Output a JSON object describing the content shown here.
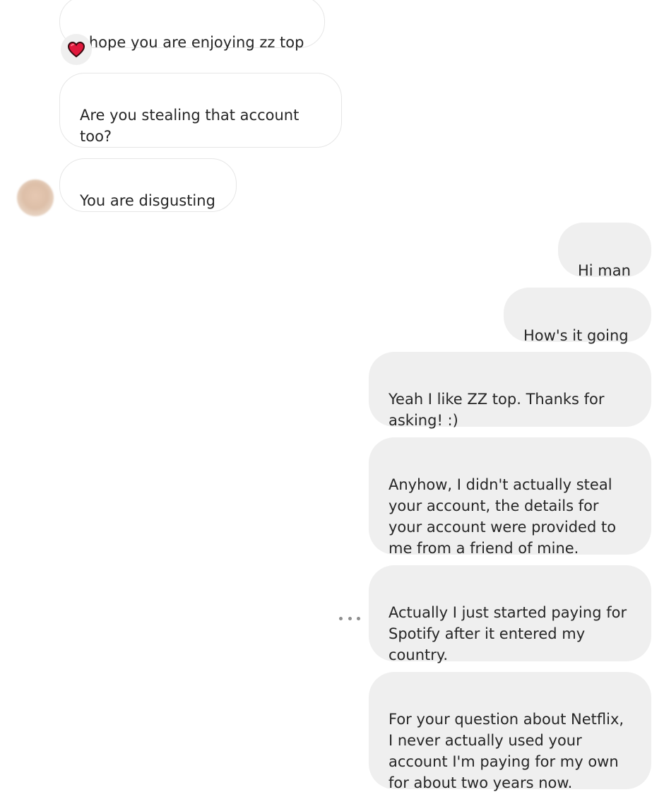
{
  "incoming": [
    {
      "text": "I hope you are enjoying zz top"
    },
    {
      "text": "Are you stealing that account\ntoo?"
    },
    {
      "text": "You are disgusting"
    }
  ],
  "outgoing": [
    {
      "text": "Hi man"
    },
    {
      "text": "How's it going"
    },
    {
      "text": "Yeah I like ZZ top. Thanks for\nasking! :)"
    },
    {
      "text": "Anyhow, I didn't actually steal\nyour account, the details for\nyour account were provided to\nme from a friend of mine."
    },
    {
      "text": "Actually I just started paying for\nSpotify after it entered my\ncountry."
    },
    {
      "text": "For your question about Netflix,\nI never actually used your\naccount I'm paying for my own\nfor about two years now."
    }
  ],
  "reaction": {
    "icon": "heart-icon",
    "color": "#e0183c"
  },
  "colors": {
    "outgoing_bubble": "#efefef",
    "incoming_border": "#e6e6e6",
    "text": "#262626"
  }
}
